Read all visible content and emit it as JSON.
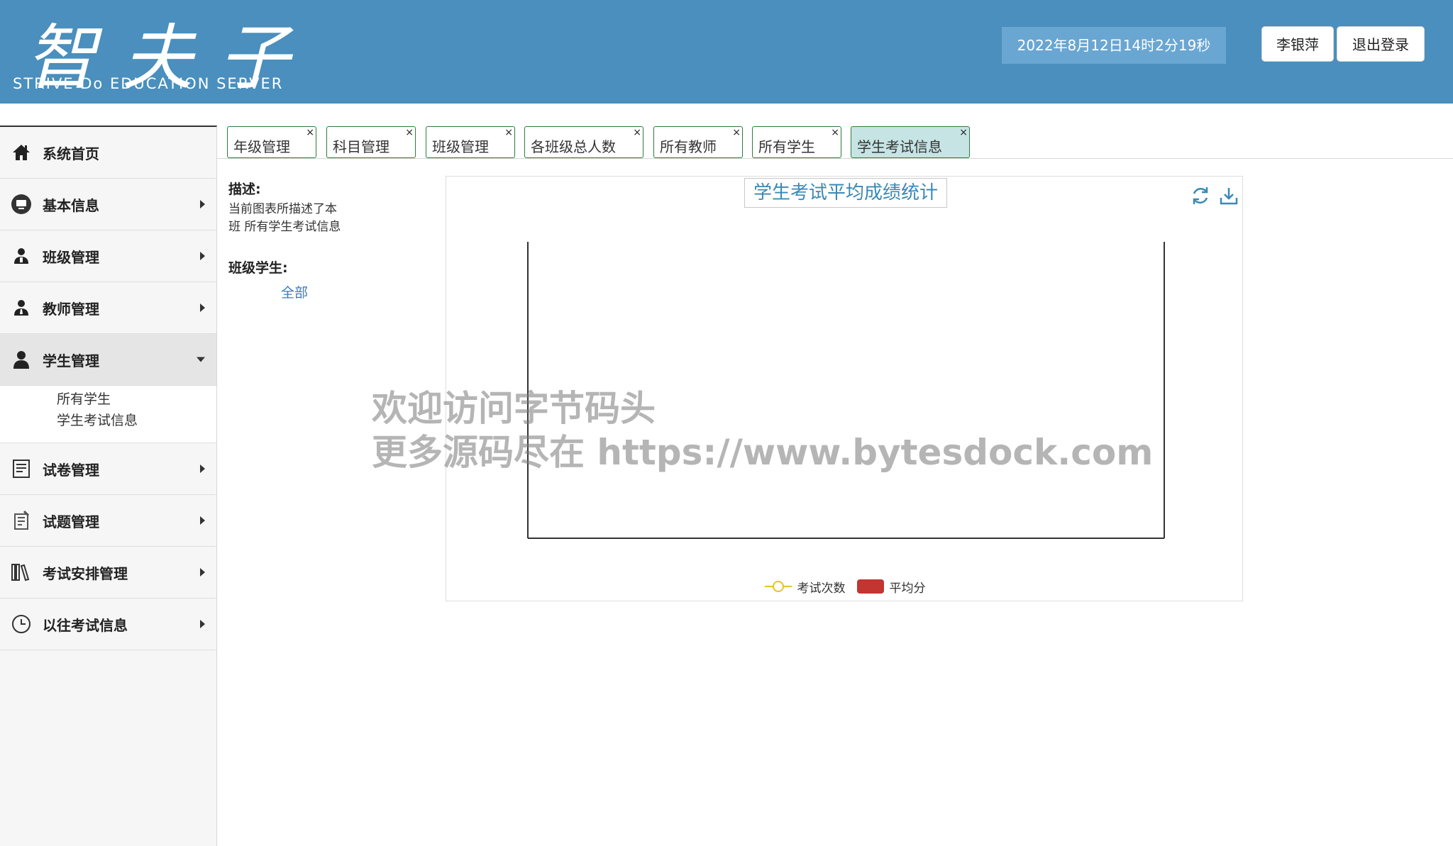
{
  "header": {
    "logo_cn": "智夫子",
    "logo_en": "STRIVE Do EDUCATION SERVER",
    "datetime": "2022年8月12日14时2分19秒",
    "user_name": "李银萍",
    "logout_label": "退出登录",
    "bg_color": "#4a8fbd"
  },
  "sidebar": {
    "items": [
      {
        "label": "系统首页",
        "icon": "home-icon"
      },
      {
        "label": "基本信息",
        "icon": "monitor-icon"
      },
      {
        "label": "班级管理",
        "icon": "user-group-icon"
      },
      {
        "label": "教师管理",
        "icon": "teacher-icon"
      },
      {
        "label": "学生管理",
        "icon": "student-icon"
      },
      {
        "label": "试卷管理",
        "icon": "paper-icon"
      },
      {
        "label": "试题管理",
        "icon": "question-icon"
      },
      {
        "label": "考试安排管理",
        "icon": "books-icon"
      },
      {
        "label": "以往考试信息",
        "icon": "clock-icon"
      }
    ],
    "student_sub": [
      "所有学生",
      "学生考试信息"
    ]
  },
  "tabs": [
    {
      "label": "年级管理"
    },
    {
      "label": "科目管理"
    },
    {
      "label": "班级管理"
    },
    {
      "label": "各班级总人数"
    },
    {
      "label": "所有教师"
    },
    {
      "label": "所有学生"
    },
    {
      "label": "学生考试信息"
    }
  ],
  "tab_close": "×",
  "description": {
    "label": "描述:",
    "text": "当前图表所描述了本班 所有学生考试信息",
    "class_label": "班级学生:",
    "all_link": "全部"
  },
  "chart_data": {
    "type": "bar",
    "title": "学生考试平均成绩统计",
    "categories": [],
    "series": [
      {
        "name": "考试次数",
        "type": "line",
        "values": [],
        "color": "#e6c229"
      },
      {
        "name": "平均分",
        "type": "bar",
        "values": [],
        "color": "#c23531"
      }
    ],
    "legend": "bottom-center",
    "grid": false
  },
  "watermark": {
    "line1": "欢迎访问字节码头",
    "line2": "更多源码尽在  https://www.bytesdock.com"
  }
}
